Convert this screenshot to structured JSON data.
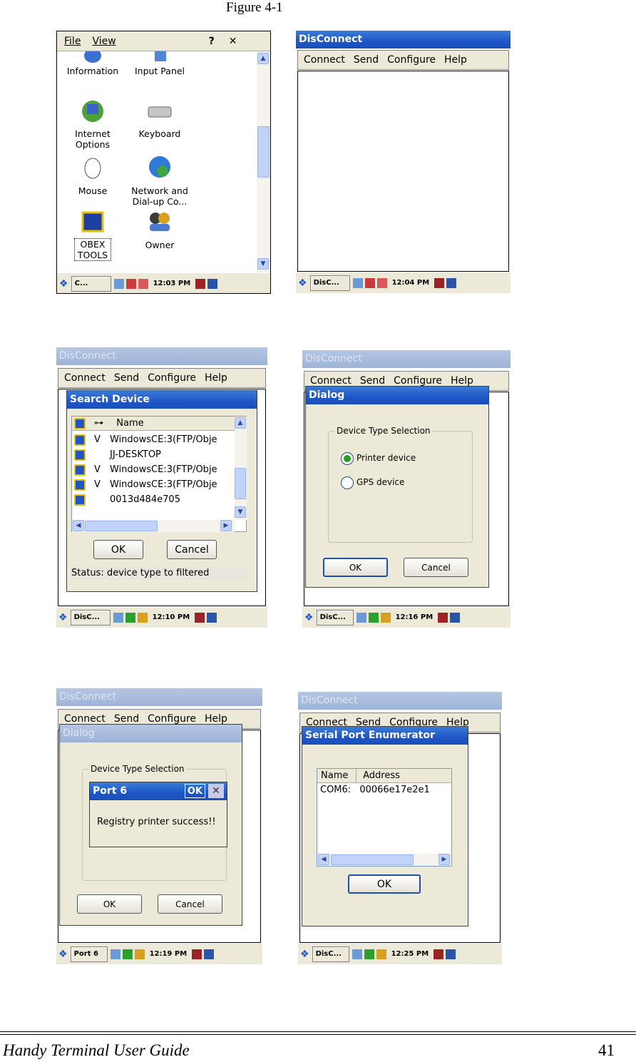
{
  "figure_caption": "Figure 4-1",
  "control_panel": {
    "menu": [
      "File",
      "View"
    ],
    "help_btn": "?",
    "close_btn": "✕",
    "items": [
      {
        "label": "Information",
        "icon": "information-icon"
      },
      {
        "label": "Input Panel",
        "icon": "input-panel-icon"
      },
      {
        "label": "Internet Options",
        "icon": "internet-options-icon"
      },
      {
        "label": "Keyboard",
        "icon": "keyboard-icon"
      },
      {
        "label": "Mouse",
        "icon": "mouse-icon"
      },
      {
        "label": "Network and Dial-up Co...",
        "icon": "network-icon"
      },
      {
        "label": "OBEX TOOLS",
        "icon": "obex-icon"
      },
      {
        "label": "Owner",
        "icon": "owner-icon"
      }
    ],
    "taskbar": {
      "task": "C...",
      "time": "12:03 PM"
    }
  },
  "app": {
    "title": "DisConnect",
    "menu": [
      "Connect",
      "Send",
      "Configure",
      "Help"
    ]
  },
  "screen2": {
    "taskbar": {
      "task": "DisC...",
      "time": "12:04 PM"
    }
  },
  "screen3": {
    "dialog_title": "Search Device",
    "columns": [
      "Name"
    ],
    "rows": [
      {
        "flag": "V",
        "name": "WindowsCE:3(FTP/Obje"
      },
      {
        "flag": "",
        "name": "JJ-DESKTOP"
      },
      {
        "flag": "V",
        "name": "WindowsCE:3(FTP/Obje"
      },
      {
        "flag": "V",
        "name": "WindowsCE:3(FTP/Obje"
      },
      {
        "flag": "",
        "name": "0013d484e705"
      }
    ],
    "ok": "OK",
    "cancel": "Cancel",
    "status": "Status:  device type to filtered",
    "taskbar": {
      "task": "DisC...",
      "time": "12:10 PM"
    }
  },
  "screen4": {
    "dialog_title": "Dialog",
    "group_label": "Device Type Selection",
    "options": [
      "Printer device",
      "GPS device"
    ],
    "selected": 0,
    "ok": "OK",
    "cancel": "Cancel",
    "taskbar": {
      "task": "DisC...",
      "time": "12:16 PM"
    }
  },
  "screen5": {
    "dialog_title": "Dialog",
    "group_label": "Device Type Selection",
    "msg_title": "Port 6",
    "msg_ok": "OK",
    "msg_text": "Registry printer success!!",
    "ok": "OK",
    "cancel": "Cancel",
    "taskbar": {
      "task": "Port 6",
      "time": "12:19 PM"
    }
  },
  "screen6": {
    "dialog_title": "Serial Port Enumerator",
    "columns": [
      "Name",
      "Address"
    ],
    "rows": [
      {
        "name": "COM6:",
        "address": "00066e17e2e1"
      }
    ],
    "ok": "OK",
    "taskbar": {
      "task": "DisC...",
      "time": "12:25 PM"
    }
  },
  "footer": {
    "title": "Handy Terminal User Guide",
    "page": "41"
  },
  "colors": {
    "title_active": "#1e56c8",
    "dialog_bg": "#ece9d8",
    "scroll": "#c1d3fb"
  }
}
